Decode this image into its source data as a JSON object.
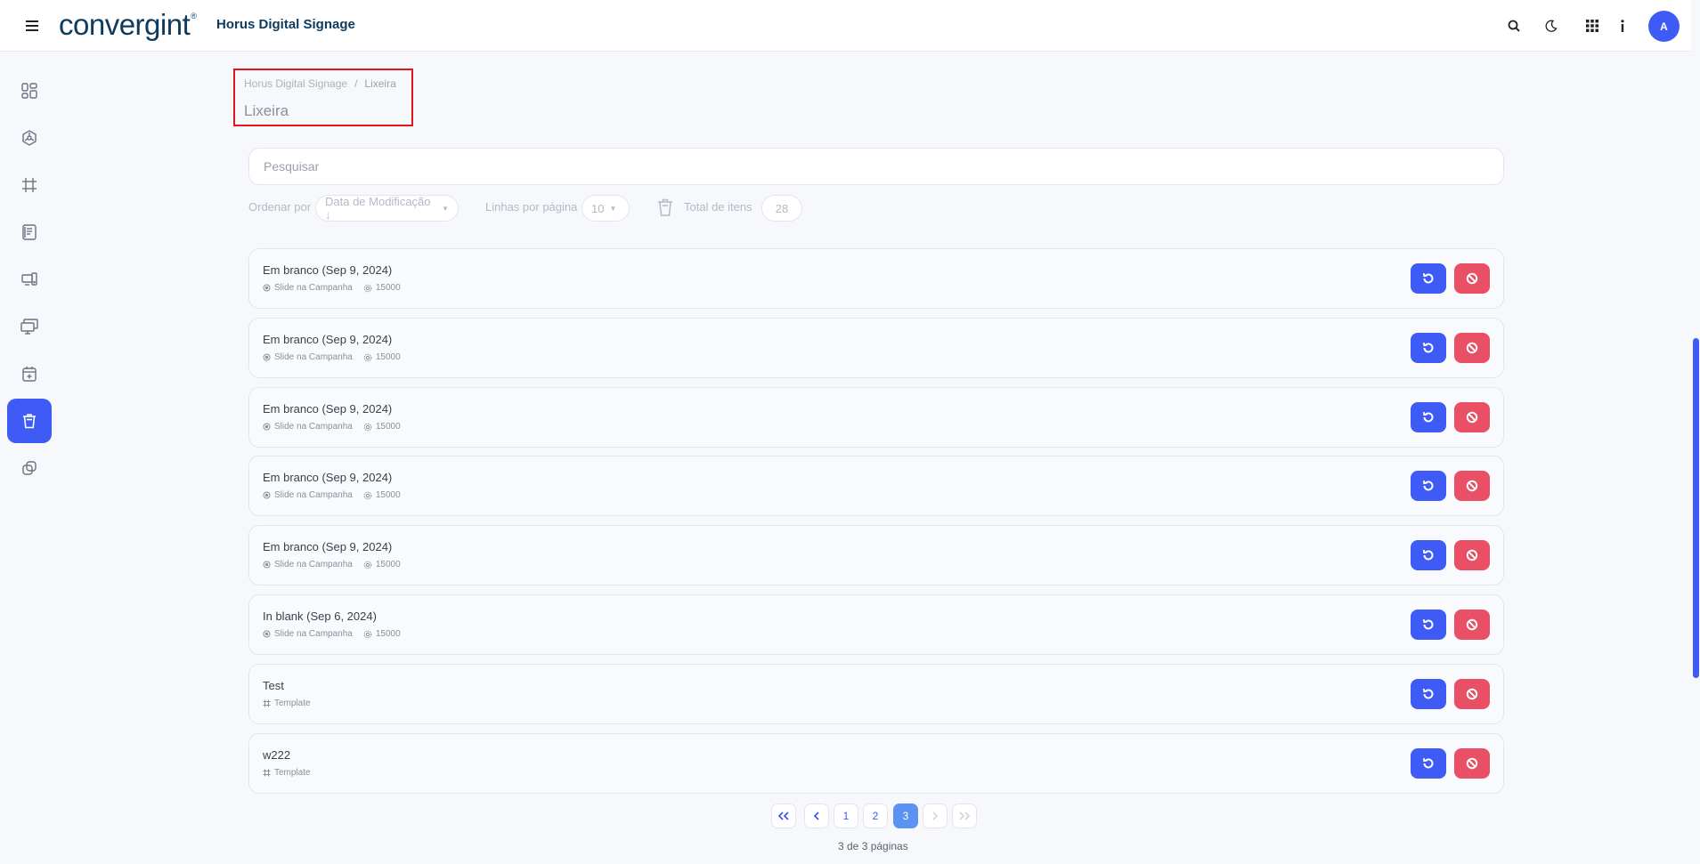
{
  "header": {
    "logo_text": "convergint",
    "app_title": "Horus Digital Signage",
    "avatar_initial": "A"
  },
  "breadcrumb": {
    "root": "Horus Digital Signage",
    "separator": "/",
    "current": "Lixeira"
  },
  "page_title": "Lixeira",
  "search": {
    "placeholder": "Pesquisar",
    "value": ""
  },
  "filters": {
    "order_label": "Ordenar por",
    "order_value": "Data de Modificação ↓",
    "rows_label": "Linhas por página",
    "rows_value": "10",
    "total_label": "Total de itens",
    "total_value": "28"
  },
  "items": [
    {
      "name": "Em branco (Sep 9, 2024)",
      "type": "Slide na Campanha",
      "duration": "15000"
    },
    {
      "name": "Em branco (Sep 9, 2024)",
      "type": "Slide na Campanha",
      "duration": "15000"
    },
    {
      "name": "Em branco (Sep 9, 2024)",
      "type": "Slide na Campanha",
      "duration": "15000"
    },
    {
      "name": "Em branco (Sep 9, 2024)",
      "type": "Slide na Campanha",
      "duration": "15000"
    },
    {
      "name": "Em branco (Sep 9, 2024)",
      "type": "Slide na Campanha",
      "duration": "15000"
    },
    {
      "name": "In blank (Sep 6, 2024)",
      "type": "Slide na Campanha",
      "duration": "15000"
    },
    {
      "name": "Test",
      "type": "Template",
      "duration": ""
    },
    {
      "name": "w222",
      "type": "Template",
      "duration": ""
    }
  ],
  "pagination": {
    "pages": [
      "1",
      "2",
      "3"
    ],
    "current_page": "3",
    "info": "3 de 3 páginas"
  },
  "colors": {
    "primary": "#3f5bf6",
    "danger": "#ea5065",
    "brand_navy": "#0d3b5e",
    "highlight_border": "#e3161b"
  },
  "icons": {
    "header": [
      "menu-icon",
      "search-icon",
      "moon-icon",
      "apps-grid-icon",
      "info-icon"
    ],
    "sidebar": [
      "dashboard-icon",
      "campaign-icon",
      "frame-icon",
      "newspaper-icon",
      "devices-icon",
      "screens-icon",
      "calendar-plus-icon",
      "trash-icon",
      "copy-icon"
    ]
  }
}
